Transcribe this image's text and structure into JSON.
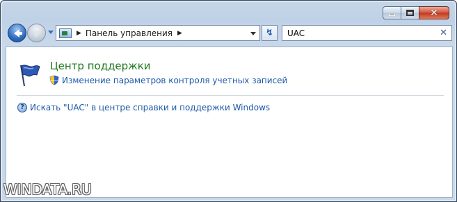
{
  "window": {
    "caption_buttons": {
      "minimize_icon": "minimize-icon",
      "maximize_icon": "maximize-icon",
      "close_icon": "close-icon",
      "close_glyph": "✕"
    }
  },
  "navigation": {
    "back_icon": "back-arrow-icon",
    "forward_icon": "forward-arrow-icon",
    "recent_pages_icon": "chevron-down-icon"
  },
  "address": {
    "location_icon": "control-panel-icon",
    "separator": "▶",
    "breadcrumb": "Панель управления",
    "trailing_separator": "▶"
  },
  "refresh": {
    "glyph": "↯",
    "icon": "refresh-icon"
  },
  "search": {
    "value": "UAC",
    "clear_glyph": "✕"
  },
  "results": [
    {
      "title": "Центр поддержки",
      "icon": "flag-icon",
      "task": {
        "icon": "uac-shield-icon",
        "label": "Изменение параметров контроля учетных записей"
      }
    }
  ],
  "help": {
    "icon": "help-icon",
    "glyph": "?",
    "label": "Искать \"UAC\" в центре справки и поддержки Windows"
  },
  "watermark": "WINDATA.RU",
  "colors": {
    "title_green": "#1f7a1f",
    "link_blue": "#1e5aa8",
    "close_red": "#c3391e"
  }
}
